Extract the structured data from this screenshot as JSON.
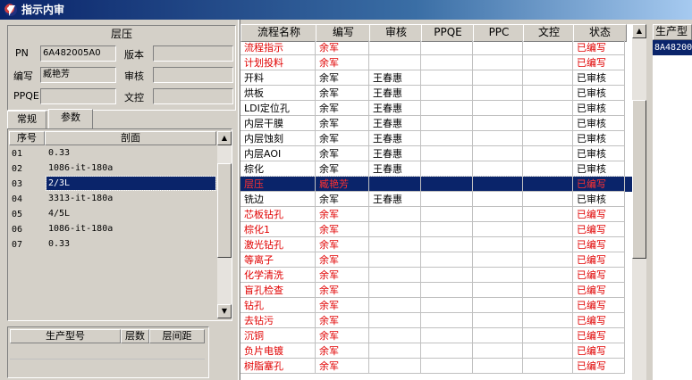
{
  "window": {
    "title": "指示内审"
  },
  "header_panel": {
    "title": "层压",
    "pn_label": "PN",
    "pn_value": "6A482005A0",
    "version_label": "版本",
    "version_value": "",
    "writer_label": "编写",
    "writer_value": "臧艳芳",
    "reviewer_label": "审核",
    "reviewer_value": "",
    "ppqe_label": "PPQE",
    "ppqe_value": "",
    "doc_control_label": "文控",
    "doc_control_value": ""
  },
  "tabs": [
    {
      "label": "常规",
      "active": false
    },
    {
      "label": "参数",
      "active": true
    }
  ],
  "profile_list": {
    "columns": [
      "序号",
      "剖面"
    ],
    "rows": [
      {
        "no": "01",
        "section": "0.33"
      },
      {
        "no": "02",
        "section": "1086-it-180a"
      },
      {
        "no": "03",
        "section": "2/3L",
        "selected": true
      },
      {
        "no": "04",
        "section": "3313-it-180a"
      },
      {
        "no": "05",
        "section": "4/5L"
      },
      {
        "no": "06",
        "section": "1086-it-180a"
      },
      {
        "no": "07",
        "section": "0.33"
      }
    ]
  },
  "model_table": {
    "columns": [
      "生产型号",
      "层数",
      "层间距"
    ]
  },
  "process_grid": {
    "columns": [
      "流程名称",
      "编写",
      "审核",
      "PPQE",
      "PPC",
      "文控",
      "状态"
    ],
    "rows": [
      {
        "name": "流程指示",
        "writer": "余军",
        "reviewer": "",
        "ppqe": "",
        "ppc": "",
        "doc": "",
        "status": "已编写",
        "red": true
      },
      {
        "name": "计划投料",
        "writer": "余军",
        "reviewer": "",
        "ppqe": "",
        "ppc": "",
        "doc": "",
        "status": "已编写",
        "red": true
      },
      {
        "name": "开料",
        "writer": "余军",
        "reviewer": "王春惠",
        "ppqe": "",
        "ppc": "",
        "doc": "",
        "status": "已审核",
        "red": false
      },
      {
        "name": "烘板",
        "writer": "余军",
        "reviewer": "王春惠",
        "ppqe": "",
        "ppc": "",
        "doc": "",
        "status": "已审核",
        "red": false
      },
      {
        "name": "LDI定位孔",
        "writer": "余军",
        "reviewer": "王春惠",
        "ppqe": "",
        "ppc": "",
        "doc": "",
        "status": "已审核",
        "red": false
      },
      {
        "name": "内层干膜",
        "writer": "余军",
        "reviewer": "王春惠",
        "ppqe": "",
        "ppc": "",
        "doc": "",
        "status": "已审核",
        "red": false
      },
      {
        "name": "内层蚀刻",
        "writer": "余军",
        "reviewer": "王春惠",
        "ppqe": "",
        "ppc": "",
        "doc": "",
        "status": "已审核",
        "red": false
      },
      {
        "name": "内层AOI",
        "writer": "余军",
        "reviewer": "王春惠",
        "ppqe": "",
        "ppc": "",
        "doc": "",
        "status": "已审核",
        "red": false
      },
      {
        "name": "棕化",
        "writer": "余军",
        "reviewer": "王春惠",
        "ppqe": "",
        "ppc": "",
        "doc": "",
        "status": "已审核",
        "red": false
      },
      {
        "name": "层压",
        "writer": "臧艳芳",
        "reviewer": "",
        "ppqe": "",
        "ppc": "",
        "doc": "",
        "status": "已编写",
        "red": true,
        "selected": true
      },
      {
        "name": "铣边",
        "writer": "余军",
        "reviewer": "王春惠",
        "ppqe": "",
        "ppc": "",
        "doc": "",
        "status": "已审核",
        "red": false
      },
      {
        "name": "芯板钻孔",
        "writer": "余军",
        "reviewer": "",
        "ppqe": "",
        "ppc": "",
        "doc": "",
        "status": "已编写",
        "red": true
      },
      {
        "name": "棕化1",
        "writer": "余军",
        "reviewer": "",
        "ppqe": "",
        "ppc": "",
        "doc": "",
        "status": "已编写",
        "red": true
      },
      {
        "name": "激光钻孔",
        "writer": "余军",
        "reviewer": "",
        "ppqe": "",
        "ppc": "",
        "doc": "",
        "status": "已编写",
        "red": true
      },
      {
        "name": "等离子",
        "writer": "余军",
        "reviewer": "",
        "ppqe": "",
        "ppc": "",
        "doc": "",
        "status": "已编写",
        "red": true
      },
      {
        "name": "化学清洗",
        "writer": "余军",
        "reviewer": "",
        "ppqe": "",
        "ppc": "",
        "doc": "",
        "status": "已编写",
        "red": true
      },
      {
        "name": "盲孔检查",
        "writer": "余军",
        "reviewer": "",
        "ppqe": "",
        "ppc": "",
        "doc": "",
        "status": "已编写",
        "red": true
      },
      {
        "name": "钻孔",
        "writer": "余军",
        "reviewer": "",
        "ppqe": "",
        "ppc": "",
        "doc": "",
        "status": "已编写",
        "red": true
      },
      {
        "name": "去钻污",
        "writer": "余军",
        "reviewer": "",
        "ppqe": "",
        "ppc": "",
        "doc": "",
        "status": "已编写",
        "red": true
      },
      {
        "name": "沉铜",
        "writer": "余军",
        "reviewer": "",
        "ppqe": "",
        "ppc": "",
        "doc": "",
        "status": "已编写",
        "red": true
      },
      {
        "name": "负片电镀",
        "writer": "余军",
        "reviewer": "",
        "ppqe": "",
        "ppc": "",
        "doc": "",
        "status": "已编写",
        "red": true
      },
      {
        "name": "树脂塞孔",
        "writer": "余军",
        "reviewer": "",
        "ppqe": "",
        "ppc": "",
        "doc": "",
        "status": "已编写",
        "red": true
      }
    ]
  },
  "model_panel": {
    "header": "生产型",
    "value": "8A48200"
  },
  "colors": {
    "title_bar": "#0a246a",
    "selection": "#0a246a",
    "red_text": "#e00000",
    "face": "#d4d0c8"
  },
  "icons": {
    "app": "app-icon",
    "up": "scroll-up-arrow-icon",
    "down": "scroll-down-arrow-icon"
  }
}
